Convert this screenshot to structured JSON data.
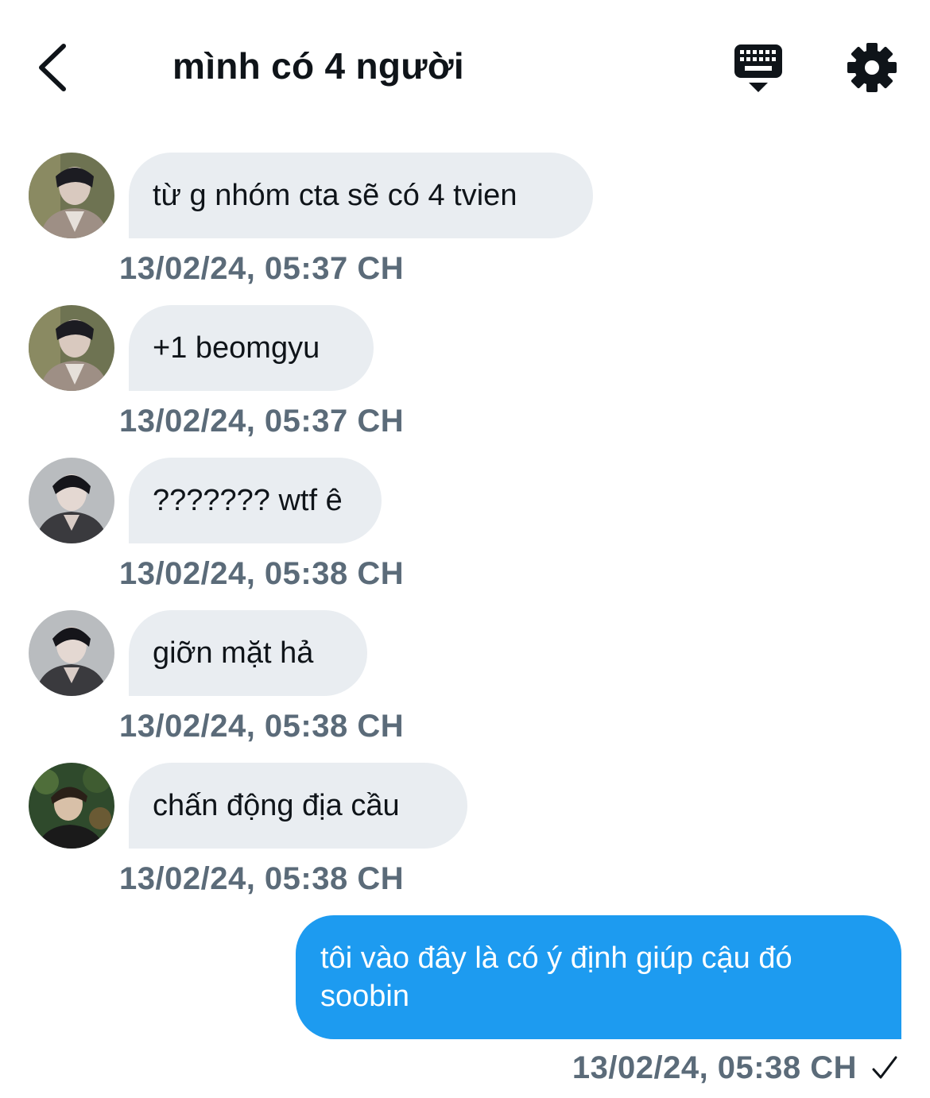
{
  "header": {
    "title": "mình có 4 người",
    "back_icon": "chevron-left-icon",
    "keyboard_icon": "keyboard-icon",
    "settings_icon": "gear-icon"
  },
  "messages": [
    {
      "direction": "incoming",
      "avatar": "avatar-1",
      "text": "từ g nhóm cta sẽ có 4 tvien",
      "time": "13/02/24, 05:37 CH"
    },
    {
      "direction": "incoming",
      "avatar": "avatar-1",
      "text": "+1 beomgyu",
      "time": "13/02/24, 05:37 CH"
    },
    {
      "direction": "incoming",
      "avatar": "avatar-2",
      "text": "??????? wtf ê",
      "time": "13/02/24, 05:38 CH"
    },
    {
      "direction": "incoming",
      "avatar": "avatar-2",
      "text": "giỡn mặt hả",
      "time": "13/02/24, 05:38 CH"
    },
    {
      "direction": "incoming",
      "avatar": "avatar-3",
      "text": "chấn động địa cầu",
      "time": "13/02/24, 05:38 CH"
    },
    {
      "direction": "outgoing",
      "text": "tôi vào đây là có ý định giúp cậu đó soobin",
      "time": "13/02/24, 05:38 CH",
      "status_icon": "checkmark-icon"
    }
  ],
  "colors": {
    "incoming_bubble": "#e9edf1",
    "outgoing_bubble": "#1d9bf0",
    "timestamp": "#5b6b79",
    "text": "#0f1419"
  }
}
